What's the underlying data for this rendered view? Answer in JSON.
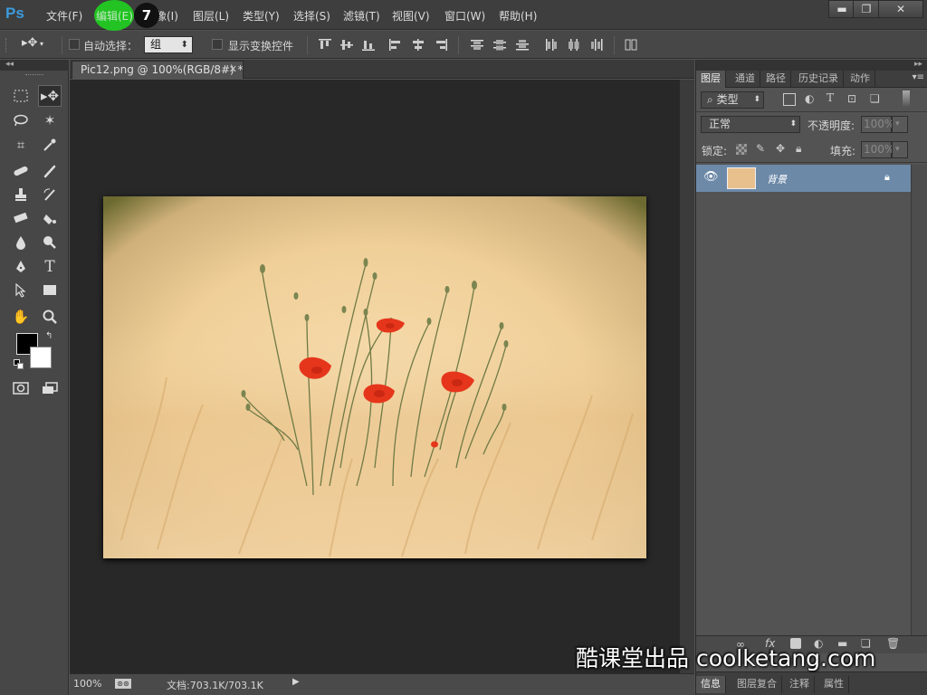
{
  "app": {
    "logo": "Ps"
  },
  "menu": [
    "文件(F)",
    "编辑(E)",
    "图像(I)",
    "图层(L)",
    "类型(Y)",
    "选择(S)",
    "滤镜(T)",
    "视图(V)",
    "窗口(W)",
    "帮助(H)"
  ],
  "annotation": {
    "step": "7"
  },
  "window_controls": {
    "minimize": "▬",
    "restore": "❐",
    "close": "✕"
  },
  "options": {
    "auto_select_label": "自动选择：",
    "auto_select_value": "组",
    "show_transform_label": "显示变换控件"
  },
  "document": {
    "tab_title": "Pic12.png @ 100%(RGB/8#) *",
    "zoom": "100%",
    "doc_info": "文档:703.1K/703.1K"
  },
  "panel": {
    "tabs": [
      "图层",
      "通道",
      "路径",
      "历史记录",
      "动作"
    ],
    "filter_kind": "类型",
    "blend_mode": "正常",
    "opacity_label": "不透明度:",
    "opacity_value": "100%",
    "lock_label": "锁定:",
    "fill_label": "填充:",
    "fill_value": "100%",
    "layer_name": "背景",
    "bottom_tabs": [
      "信息",
      "图层复合",
      "注释",
      "属性"
    ]
  },
  "watermark": "酷课堂出品 coolketang.com",
  "colors": {
    "accent": "#3b9bdd",
    "layer_selected": "#6c89a8",
    "foreground": "#000000",
    "background": "#ffffff",
    "click_marker": "#22c322"
  }
}
